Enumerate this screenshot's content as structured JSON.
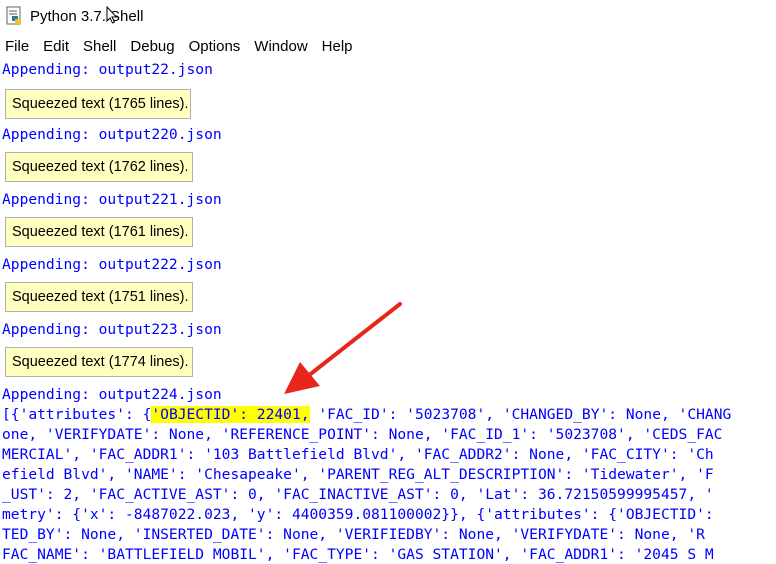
{
  "window": {
    "title": "Python 3.7.  Shell"
  },
  "menu": [
    "File",
    "Edit",
    "Shell",
    "Debug",
    "Options",
    "Window",
    "Help"
  ],
  "shell": {
    "entries": [
      {
        "appending": "Appending: output22.json",
        "squeezed": "Squeezed text (1765 lines)."
      },
      {
        "appending": "Appending: output220.json",
        "squeezed": "Squeezed text (1762 lines)."
      },
      {
        "appending": "Appending: output221.json",
        "squeezed": "Squeezed text (1761 lines)."
      },
      {
        "appending": "Appending: output222.json",
        "squeezed": "Squeezed text (1751 lines)."
      },
      {
        "appending": "Appending: output223.json",
        "squeezed": "Squeezed text (1774 lines)."
      }
    ],
    "last_appending": "Appending: output224.json",
    "output_first_prefix": "[{'attributes': {",
    "output_highlight": "'OBJECTID': 22401,",
    "output_first_suffix": " 'FAC_ID': '5023708', 'CHANGED_BY': None, 'CHANG",
    "output_lines": [
      "one, 'VERIFYDATE': None, 'REFERENCE_POINT': None, 'FAC_ID_1': '5023708', 'CEDS_FAC",
      "MERCIAL', 'FAC_ADDR1': '103 Battlefield Blvd', 'FAC_ADDR2': None, 'FAC_CITY': 'Ch",
      "efield Blvd', 'NAME': 'Chesapeake', 'PARENT_REG_ALT_DESCRIPTION': 'Tidewater', 'F",
      "_UST': 2, 'FAC_ACTIVE_AST': 0, 'FAC_INACTIVE_AST': 0, 'Lat': 36.72150599995457, '",
      "metry': {'x': -8487022.023, 'y': 4400359.081100002}}, {'attributes': {'OBJECTID':",
      "TED_BY': None, 'INSERTED_DATE': None, 'VERIFIEDBY': None, 'VERIFYDATE': None, 'R",
      "FAC_NAME': 'BATTLEFIELD MOBIL', 'FAC_TYPE': 'GAS STATION', 'FAC_ADDR1': '2045 S M"
    ]
  },
  "colors": {
    "prompt_blue": "#0000ff",
    "squeezed_bg": "#ffffc0",
    "highlight": "#ffff00",
    "arrow": "#e8261c"
  },
  "icons": {
    "app": "python-idle-icon",
    "cursor": "mouse-cursor-icon",
    "annotation": "red-arrow-icon"
  }
}
